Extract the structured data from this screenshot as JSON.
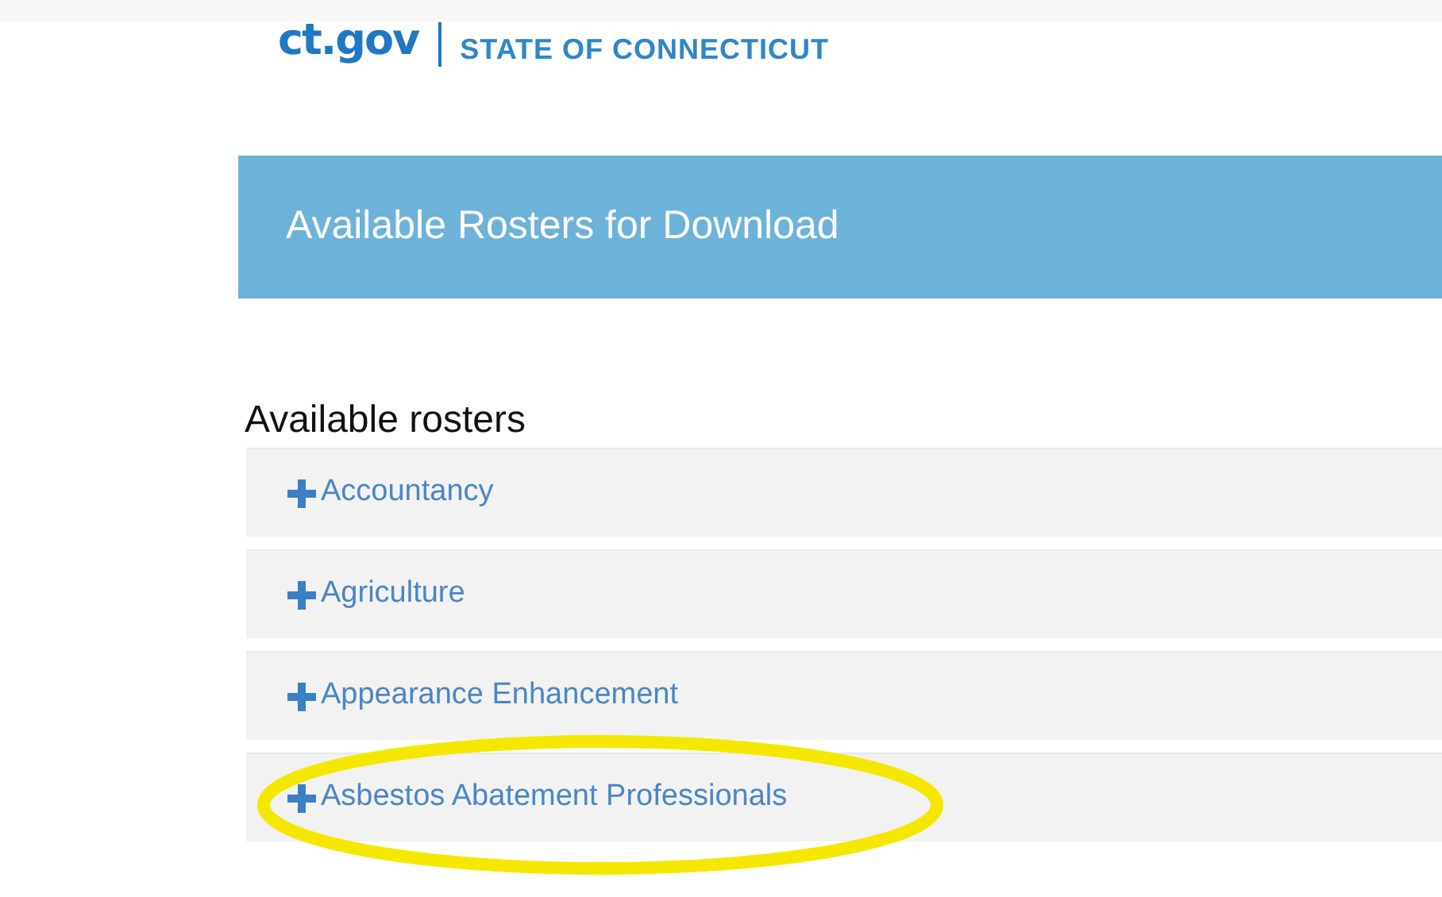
{
  "header": {
    "logo": "ct.gov",
    "state_name": "STATE OF CONNECTICUT"
  },
  "banner": {
    "title": "Available Rosters for Download"
  },
  "section": {
    "heading": "Available rosters"
  },
  "rosters": [
    {
      "label": "Accountancy",
      "expanded": false,
      "highlighted": false
    },
    {
      "label": "Agriculture",
      "expanded": false,
      "highlighted": false
    },
    {
      "label": "Appearance Enhancement",
      "expanded": false,
      "highlighted": false
    },
    {
      "label": "Asbestos Abatement Professionals",
      "expanded": false,
      "highlighted": true
    }
  ]
}
